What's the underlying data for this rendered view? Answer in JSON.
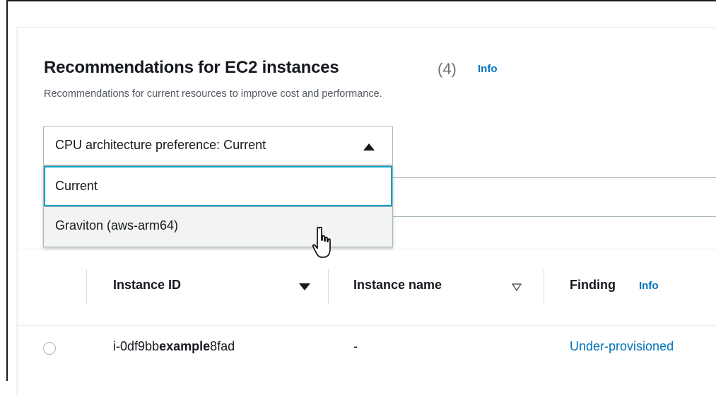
{
  "panel": {
    "title": "Recommendations for EC2 instances",
    "count": "(4)",
    "info_label": "Info",
    "subtitle": "Recommendations for current resources to improve cost and performance."
  },
  "cpu_preference": {
    "label": "CPU architecture preference: Current",
    "options": [
      "Current",
      "Graviton (aws-arm64)"
    ]
  },
  "table": {
    "columns": [
      "Instance ID",
      "Instance name",
      "Finding"
    ],
    "finding_info": "Info",
    "rows": [
      {
        "instance_id_prefix": "i-0df9bb",
        "instance_id_bold": "example",
        "instance_id_suffix": "8fad",
        "instance_name": "-",
        "finding": "Under-provisioned"
      }
    ]
  },
  "colors": {
    "link": "#0073bb",
    "focus_border": "#00a1c9",
    "text": "#16191f",
    "secondary": "#545b64"
  }
}
